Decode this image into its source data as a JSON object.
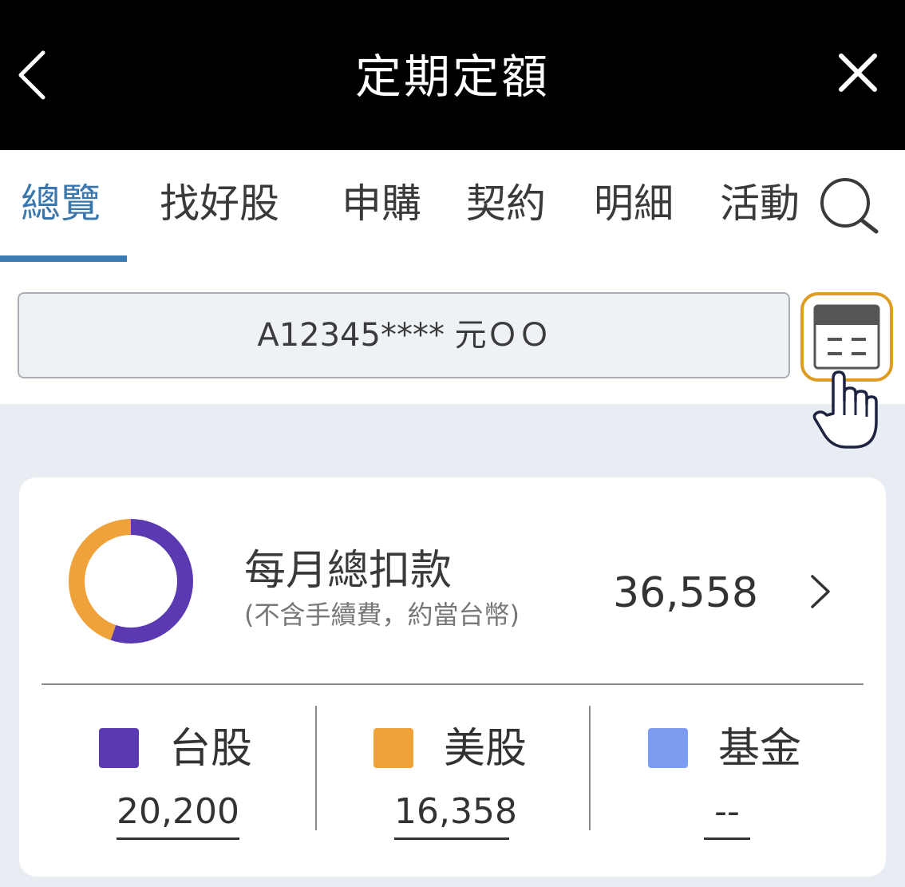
{
  "header": {
    "title": "定期定額",
    "back_icon": "chevron-left-icon",
    "close_icon": "close-icon"
  },
  "tabs": [
    {
      "label": "總覽",
      "active": true
    },
    {
      "label": "找好股",
      "active": false
    },
    {
      "label": "申購",
      "active": false
    },
    {
      "label": "契約",
      "active": false
    },
    {
      "label": "明細",
      "active": false
    },
    {
      "label": "活動",
      "active": false
    }
  ],
  "search_icon": "search-icon",
  "account": {
    "display": "A12345**** 元ＯＯ",
    "calendar_icon": "calendar-icon",
    "pointer_icon": "hand-pointer-icon"
  },
  "summary": {
    "title": "每月總扣款",
    "subtitle": "(不含手續費，約當台幣)",
    "total": "36,558",
    "chevron_icon": "chevron-right-icon"
  },
  "chart_data": {
    "type": "pie",
    "categories": [
      "台股",
      "美股",
      "基金"
    ],
    "values": [
      20200,
      16358,
      0
    ],
    "colors": [
      "#5b39b0",
      "#efa239",
      "#7b9cf0"
    ]
  },
  "breakdown": [
    {
      "label": "台股",
      "value": "20,200",
      "color": "#5b39b0"
    },
    {
      "label": "美股",
      "value": "16,358",
      "color": "#efa239"
    },
    {
      "label": "基金",
      "value": "--",
      "color": "#7b9cf0"
    }
  ],
  "colors": {
    "header_bg": "#000000",
    "active_tab": "#3b77ad",
    "highlight": "#de9d22"
  }
}
